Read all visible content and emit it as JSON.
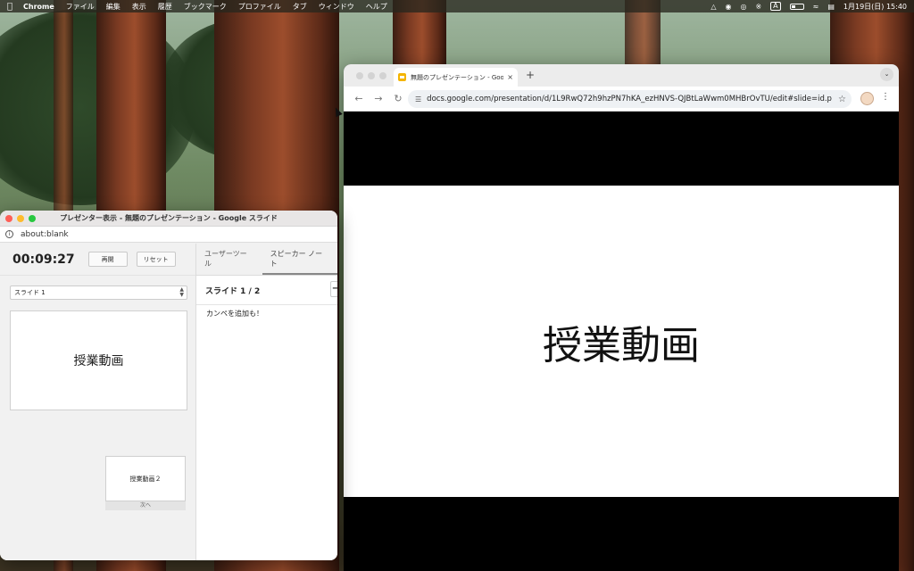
{
  "menubar": {
    "app": "Chrome",
    "items": [
      "ファイル",
      "編集",
      "表示",
      "履歴",
      "ブックマーク",
      "プロファイル",
      "タブ",
      "ウィンドウ",
      "ヘルプ"
    ],
    "status_a": "A",
    "datetime": "1月19日(日)  15:40"
  },
  "presenter": {
    "window_title": "プレゼンター表示 - 無題のプレゼンテーション - Google スライド",
    "url": "about:blank",
    "timer": "00:09:27",
    "resume_label": "再開",
    "reset_label": "リセット",
    "slide_select_value": "スライド 1",
    "current_slide_text": "授業動画",
    "next_slide_text": "授業動画２",
    "next_label": "次へ",
    "tabs": [
      "ユーザーツール",
      "スピーカー ノート"
    ],
    "active_tab_index": 1,
    "notes_header": "スライド 1 / 2",
    "notes_minus": "−",
    "notes_text": "カンペを追加も！"
  },
  "chrome": {
    "tab_title": "無題のプレゼンテーション - Goo",
    "tab_close": "×",
    "new_tab": "+",
    "url": "docs.google.com/presentation/d/1L9RwQ72h9hzPN7hKA_ezHNVS-QJBtLaWwm0MHBrOvTU/edit#slide=id.p",
    "slide_text": "授業動画"
  },
  "colors": {
    "traffic_red": "#fe5f57",
    "traffic_yellow": "#febc2e",
    "traffic_green": "#28c840",
    "slides_yellow": "#f4b400"
  }
}
